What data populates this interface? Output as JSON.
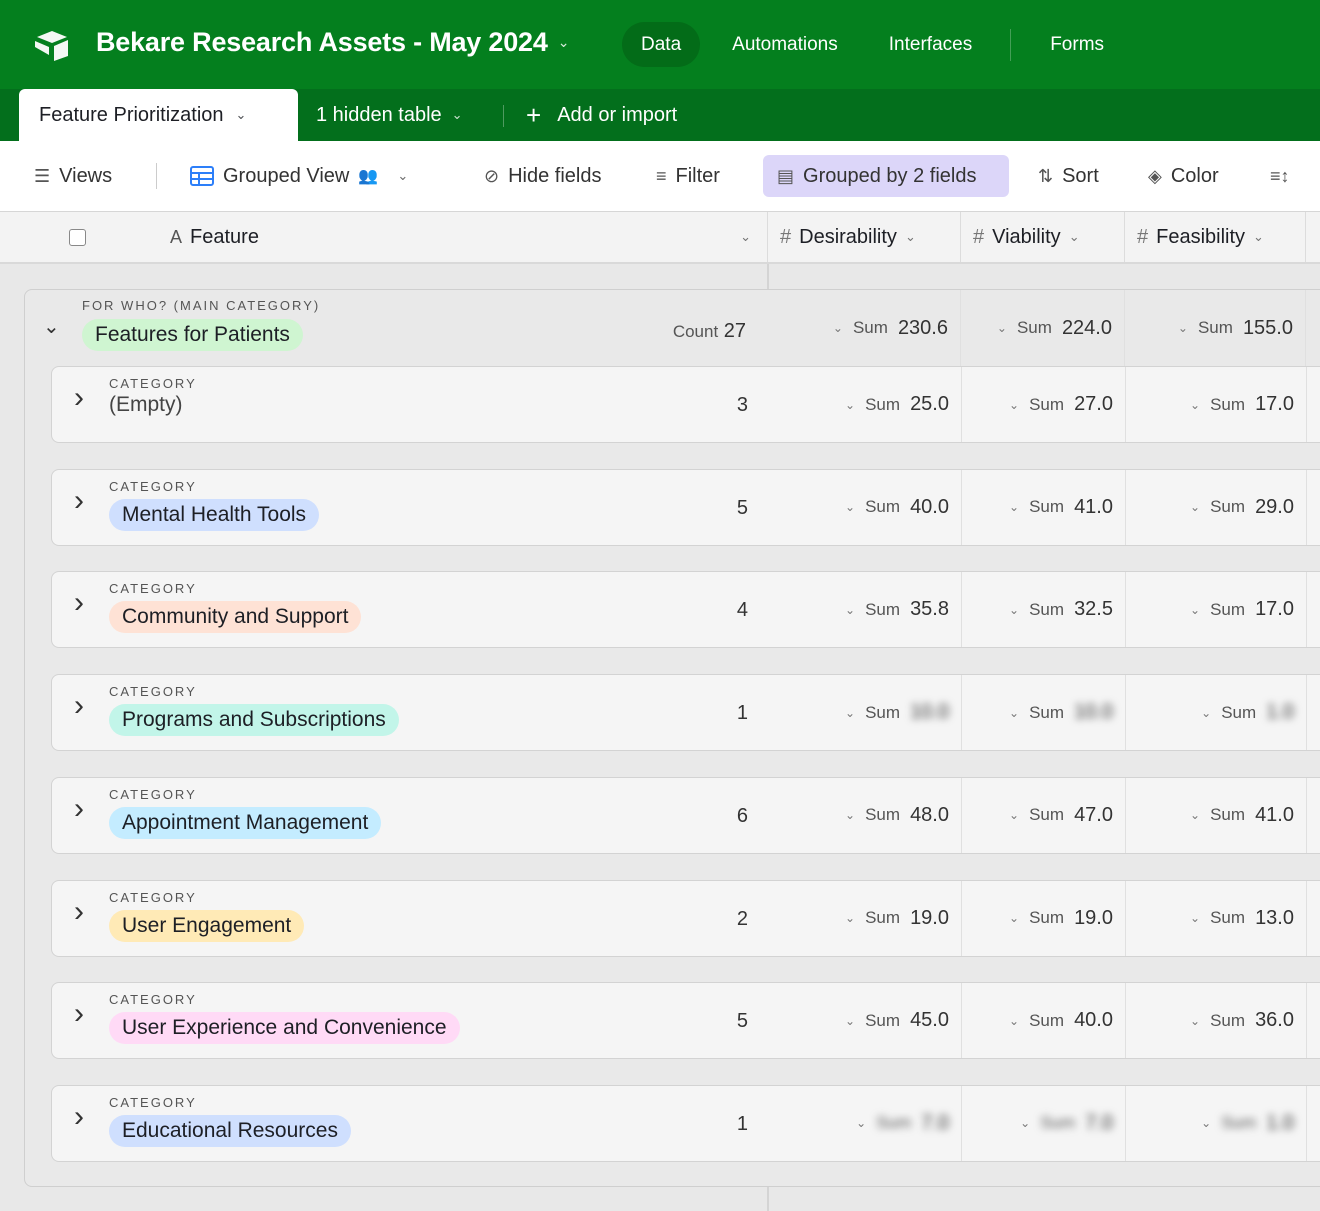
{
  "app": {
    "base_title": "Bekare Research Assets - May 2024",
    "nav": [
      "Data",
      "Automations",
      "Interfaces",
      "Forms"
    ],
    "active_nav": "Data"
  },
  "tabs": {
    "active_table": "Feature Prioritization",
    "hidden_tables": "1 hidden table",
    "add_import": "Add or import"
  },
  "toolbar": {
    "views": "Views",
    "view_name": "Grouped View",
    "hide_fields": "Hide fields",
    "filter": "Filter",
    "group": "Grouped by 2 fields",
    "sort": "Sort",
    "color": "Color"
  },
  "columns": {
    "primary": "Feature",
    "desirability": "Desirability",
    "viability": "Viability",
    "feasibility": "Feasibility"
  },
  "group": {
    "field_label": "FOR WHO? (MAIN CATEGORY)",
    "value": "Features for Patients",
    "pill_color": "#cff5d1",
    "count_label": "Count",
    "count": "27",
    "sum_label": "Sum",
    "sums": [
      "230.6",
      "224.0",
      "155.0"
    ]
  },
  "subgroups": [
    {
      "field_label": "CATEGORY",
      "value": "(Empty)",
      "empty": true,
      "pill_color": "",
      "count": "3",
      "sums": [
        "25.0",
        "27.0",
        "17.0"
      ],
      "blurred": ""
    },
    {
      "field_label": "CATEGORY",
      "value": "Mental Health Tools",
      "pill_color": "#cfdffe",
      "count": "5",
      "sums": [
        "40.0",
        "41.0",
        "29.0"
      ],
      "blurred": ""
    },
    {
      "field_label": "CATEGORY",
      "value": "Community and Support",
      "pill_color": "#fee2d5",
      "count": "4",
      "sums": [
        "35.8",
        "32.5",
        "17.0"
      ],
      "blurred": ""
    },
    {
      "field_label": "CATEGORY",
      "value": "Programs and Subscriptions",
      "pill_color": "#c2f5e9",
      "count": "1",
      "sums": [
        "10.0",
        "10.0",
        "1.0"
      ],
      "blurred": "values"
    },
    {
      "field_label": "CATEGORY",
      "value": "Appointment Management",
      "pill_color": "#c4ecff",
      "count": "6",
      "sums": [
        "48.0",
        "47.0",
        "41.0"
      ],
      "blurred": ""
    },
    {
      "field_label": "CATEGORY",
      "value": "User Engagement",
      "pill_color": "#ffeab6",
      "count": "2",
      "sums": [
        "19.0",
        "19.0",
        "13.0"
      ],
      "blurred": ""
    },
    {
      "field_label": "CATEGORY",
      "value": "User Experience and Convenience",
      "pill_color": "#ffdaf6",
      "count": "5",
      "sums": [
        "45.0",
        "40.0",
        "36.0"
      ],
      "blurred": ""
    },
    {
      "field_label": "CATEGORY",
      "value": "Educational Resources",
      "pill_color": "#cfdffe",
      "count": "1",
      "sums": [
        "7.0",
        "7.0",
        "1.0"
      ],
      "blurred": "all"
    }
  ]
}
